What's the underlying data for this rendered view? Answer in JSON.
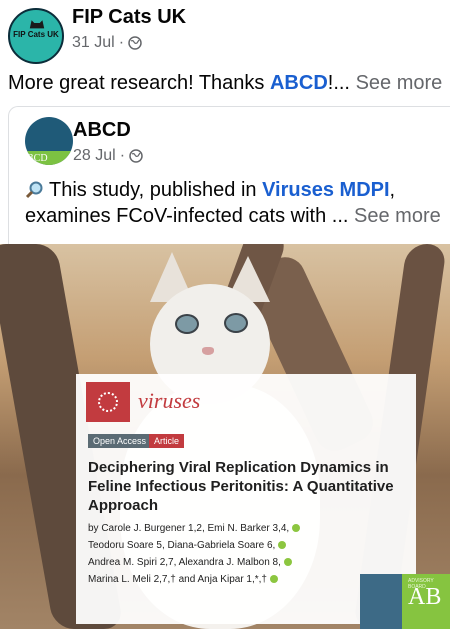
{
  "post": {
    "author": "FIP Cats UK",
    "avatar_text": "FIP Cats UK",
    "date": "31 Jul",
    "text_prefix": "More great research! Thanks ",
    "mention": "ABCD",
    "text_suffix": "!...",
    "see_more": "See more"
  },
  "shared": {
    "author": "ABCD",
    "avatar_text": "BCD",
    "date": "28 Jul",
    "line1_prefix": "This study, published in ",
    "line1_link": "Viruses MDPI",
    "line1_suffix": ",",
    "line2": "examines FCoV-infected cats with ...",
    "see_more": "See more"
  },
  "image": {
    "journal": "viruses",
    "badge_open": "Open Access",
    "badge_article": "Article",
    "title": "Deciphering Viral Replication Dynamics in Feline Infectious Peritonitis: A Quantitative Approach",
    "authors_line1": "by Carole J. Burgener 1,2, Emi N. Barker 3,4,",
    "authors_line2": "Teodoru Soare 5, Diana-Gabriela Soare 6,",
    "authors_line3": "Andrea M. Spiri 2,7, Alexandra J. Malbon 8,",
    "authors_line4": "Marina L. Meli 2,7,† and Anja Kipar 1,*,†",
    "corner_small": "ADVISORY BOARD",
    "corner_text": "AB"
  },
  "colors": {
    "link": "#1a5fd0",
    "meta": "#65676b",
    "journal_red": "#c23b3f",
    "green": "#8cc63f"
  },
  "icons": {
    "privacy": "globe-icon",
    "search": "magnifier-icon"
  }
}
